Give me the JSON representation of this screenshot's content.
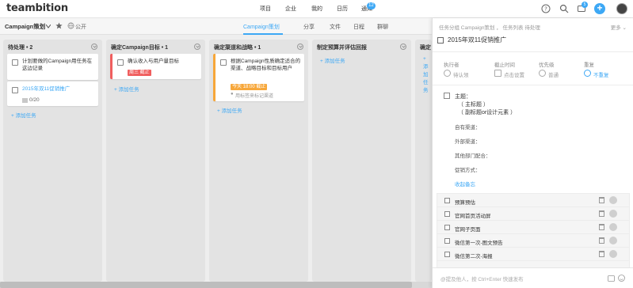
{
  "app": {
    "logo": "teambition"
  },
  "topnav": {
    "items": [
      "项目",
      "企业",
      "我的",
      "日历",
      "通知"
    ],
    "notify_badge": "12",
    "msg_badge": "5"
  },
  "project": {
    "title": "Campaign策划",
    "visibility": "公开",
    "tabs": [
      "Campaign策划",
      "分享",
      "文件",
      "日程",
      "群聊"
    ]
  },
  "columns": [
    {
      "title": "待处理 • 2",
      "cards": [
        {
          "text": "计划要做的Campaign用任务在这边记录"
        },
        {
          "text": "2015年双11促销推广",
          "subtasks": "0/20"
        }
      ],
      "add_label": "添加任务"
    },
    {
      "title": "确定Campaign目标 • 1",
      "cards": [
        {
          "text": "确认收入与用户量目标",
          "due": "周三 截止"
        }
      ],
      "add_label": "添加任务"
    },
    {
      "title": "确定渠道和战略 • 1",
      "cards": [
        {
          "text": "根据Campaign性质确定适合的渠道、战略目标和目标用户",
          "due": "今天 18:00 截止",
          "tag": "用标签来标记渠道"
        }
      ],
      "add_label": "添加任务"
    },
    {
      "title": "制定预算并评估回报",
      "cards": [],
      "add_label": "添加任务"
    },
    {
      "title": "确定",
      "cards": [],
      "add_label": "添加任务"
    }
  ],
  "panel": {
    "breadcrumb": "任务分组 Campaign策划 ， 任务列表 待处理",
    "more": "更多",
    "title": "2015年双11促销推广",
    "fields": {
      "assignee_label": "执行者",
      "assignee_value": "待认领",
      "due_label": "截止时间",
      "due_value": "点击设置",
      "priority_label": "优先级",
      "priority_value": "普通",
      "repeat_label": "重复",
      "repeat_value": "不重复"
    },
    "desc": {
      "theme": "主题：",
      "main": "（ 主标题 ）",
      "sub": "（ 副标题or设计元素 ）",
      "own": "自有渠道：",
      "external": "外部渠道：",
      "other_dept": "其他部门配合：",
      "promo": "促销方式：",
      "collapse": "收起备忘"
    },
    "subtasks": [
      "预算预估",
      "官网首页活动屏",
      "官网子页面",
      "微信第一次-图文预告",
      "微信第二次-海报"
    ],
    "comment_placeholder": "@提及他人，按 Ctrl+Enter 快速发布"
  },
  "colors": {
    "accent": "#3da8f5",
    "urgent": "#f05e5e",
    "warning": "#f7a73a"
  }
}
